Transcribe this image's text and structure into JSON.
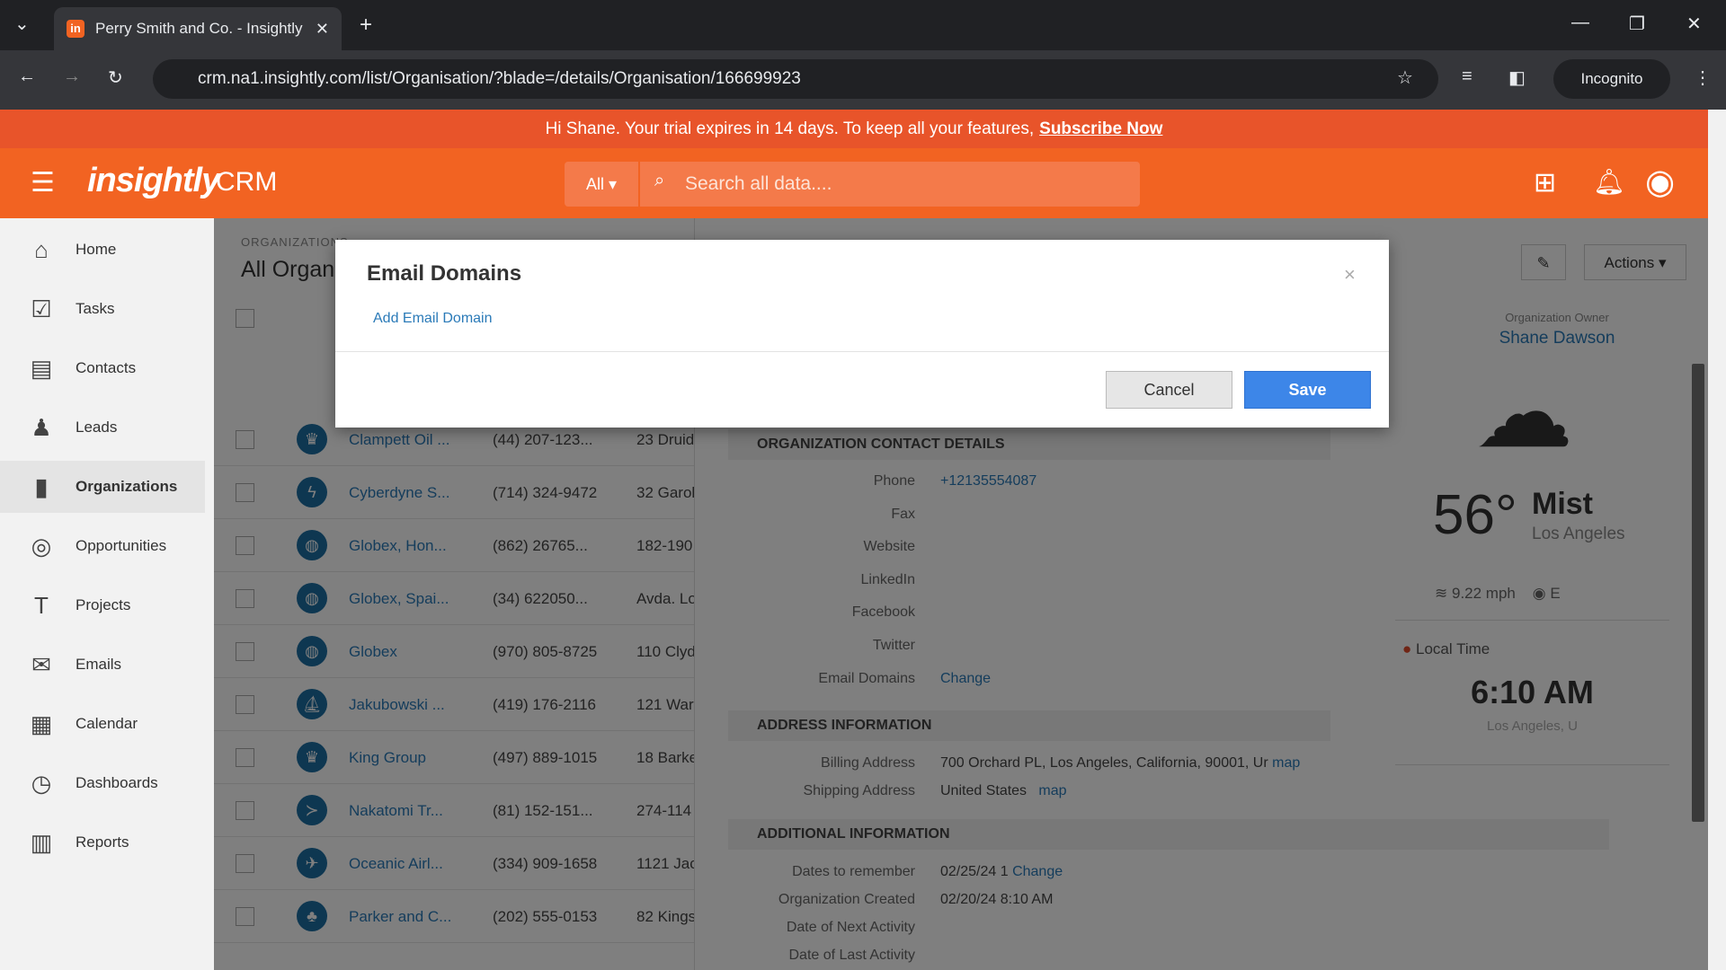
{
  "browser": {
    "tab_title": "Perry Smith and Co. - Insightly",
    "url": "crm.na1.insightly.com/list/Organisation/?blade=/details/Organisation/166699923",
    "incognito_label": "Incognito"
  },
  "banner": {
    "text": "Hi Shane. Your trial expires in 14 days. To keep all your features,",
    "link": "Subscribe Now"
  },
  "header": {
    "logo": "insightly",
    "product": "CRM",
    "scope": "All",
    "search_placeholder": "Search all data...."
  },
  "sidebar": {
    "items": [
      {
        "label": "Home",
        "icon": "home-icon",
        "glyph": "⌂"
      },
      {
        "label": "Tasks",
        "icon": "tasks-icon",
        "glyph": "☑"
      },
      {
        "label": "Contacts",
        "icon": "contacts-icon",
        "glyph": "▤"
      },
      {
        "label": "Leads",
        "icon": "leads-icon",
        "glyph": "♟"
      },
      {
        "label": "Organizations",
        "icon": "organizations-icon",
        "glyph": "▮"
      },
      {
        "label": "Opportunities",
        "icon": "opportunities-icon",
        "glyph": "◎"
      },
      {
        "label": "Projects",
        "icon": "projects-icon",
        "glyph": "T"
      },
      {
        "label": "Emails",
        "icon": "emails-icon",
        "glyph": "✉"
      },
      {
        "label": "Calendar",
        "icon": "calendar-icon",
        "glyph": "▦"
      },
      {
        "label": "Dashboards",
        "icon": "dashboards-icon",
        "glyph": "◷"
      },
      {
        "label": "Reports",
        "icon": "reports-icon",
        "glyph": "▥"
      }
    ],
    "active": "Organizations"
  },
  "list": {
    "section": "ORGANIZATIONS",
    "title": "All Organizations",
    "rows": [
      {
        "name": "Clampett Oil ...",
        "phone": "(44) 207-123...",
        "address": "23 Druid",
        "icon": "crown"
      },
      {
        "name": "Cyberdyne S...",
        "phone": "(714) 324-9472",
        "address": "32 Garol",
        "icon": "bolt"
      },
      {
        "name": "Globex, Hon...",
        "phone": "(862) 26765...",
        "address": "182-190",
        "icon": "globe"
      },
      {
        "name": "Globex, Spai...",
        "phone": "(34) 622050...",
        "address": "Avda. Lo",
        "icon": "globe"
      },
      {
        "name": "Globex",
        "phone": "(970) 805-8725",
        "address": "110 Clyd",
        "icon": "globe"
      },
      {
        "name": "Jakubowski ...",
        "phone": "(419) 176-2116",
        "address": "121 War",
        "icon": "boat"
      },
      {
        "name": "King Group",
        "phone": "(497) 889-1015",
        "address": "18 Barke",
        "icon": "crown"
      },
      {
        "name": "Nakatomi Tr...",
        "phone": "(81) 152-151...",
        "address": "274-114",
        "icon": "fish"
      },
      {
        "name": "Oceanic Airl...",
        "phone": "(334) 909-1658",
        "address": "1121 Jac",
        "icon": "plane"
      },
      {
        "name": "Parker and C...",
        "phone": "(202) 555-0153",
        "address": "82 Kings",
        "icon": "tree"
      }
    ]
  },
  "detail": {
    "actions_label": "Actions",
    "contact_section": "ORGANIZATION CONTACT DETAILS",
    "contact_fields": [
      {
        "label": "Phone",
        "value": "+12135554087",
        "link": true
      },
      {
        "label": "Fax",
        "value": ""
      },
      {
        "label": "Website",
        "value": ""
      },
      {
        "label": "LinkedIn",
        "value": ""
      },
      {
        "label": "Facebook",
        "value": ""
      },
      {
        "label": "Twitter",
        "value": ""
      },
      {
        "label": "Email Domains",
        "value": "Change",
        "link": true
      }
    ],
    "address_section": "ADDRESS INFORMATION",
    "billing_label": "Billing Address",
    "billing_value": "700 Orchard PL, Los Angeles, California, 90001, Ur",
    "billing_map": "map",
    "shipping_label": "Shipping Address",
    "shipping_value": "United States",
    "shipping_map": "map",
    "additional_section": "ADDITIONAL INFORMATION",
    "dates_label": "Dates to remember",
    "dates_value": "02/25/24 1",
    "dates_change": "Change",
    "created_label": "Organization Created",
    "created_value": "02/20/24 8:10 AM",
    "next_label": "Date of Next Activity",
    "last_label": "Date of Last Activity"
  },
  "widget": {
    "owner_label": "Organization Owner",
    "owner": "Shane Dawson",
    "temp": "56°",
    "condition": "Mist",
    "city": "Los Angeles",
    "wind": "9.22 mph",
    "direction": "E",
    "local_time_label": "Local Time",
    "time": "6:10 AM",
    "time_city": "Los Angeles, U"
  },
  "modal": {
    "title": "Email Domains",
    "add_link": "Add Email Domain",
    "cancel": "Cancel",
    "save": "Save",
    "close": "×"
  },
  "colors": {
    "brand": "#f26322",
    "banner": "#e8542a",
    "primary": "#3d86e8",
    "link": "#2a7ab8"
  }
}
